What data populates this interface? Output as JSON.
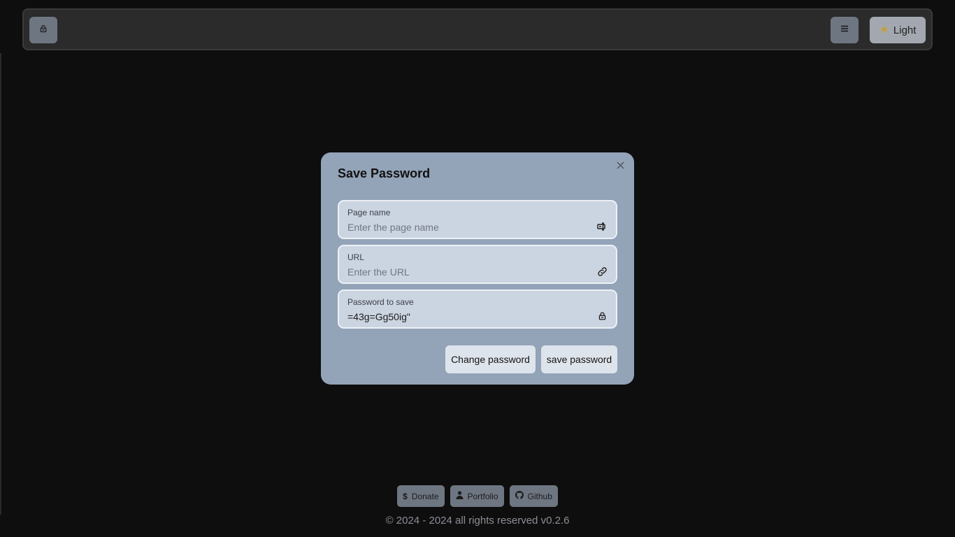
{
  "navbar": {
    "lock_icon": "lock-icon",
    "menu_icon": "hamburger-menu-icon",
    "theme_icon": "sun-icon",
    "theme_label": "Light"
  },
  "modal": {
    "title": "Save Password",
    "close_icon": "close-icon",
    "fields": [
      {
        "label": "Page name",
        "placeholder": "Enter the page name",
        "value": "",
        "icon": "page-label-icon"
      },
      {
        "label": "URL",
        "placeholder": "Enter the URL",
        "value": "",
        "icon": "link-icon"
      },
      {
        "label": "Password to save",
        "placeholder": "",
        "value": "=43g=Gg50ig\"",
        "icon": "lock-icon"
      }
    ],
    "change_password_label": "Change password",
    "save_password_label": "save password"
  },
  "footer": {
    "links": [
      {
        "label": "Donate",
        "icon": "dollar-icon"
      },
      {
        "label": "Portfolio",
        "icon": "person-icon"
      },
      {
        "label": "Github",
        "icon": "github-icon"
      }
    ],
    "copyright": "© 2024 - 2024 all rights reserved v0.2.6"
  },
  "colors": {
    "background": "#0e0e0e",
    "navbar": "#2b2b2b",
    "modal": "#93a3b8",
    "field": "#cbd4e1",
    "button": "#dee4ec"
  }
}
